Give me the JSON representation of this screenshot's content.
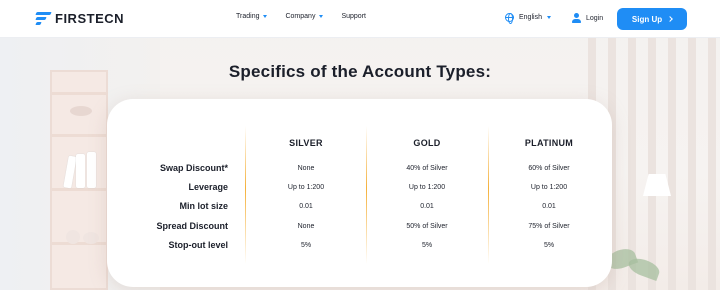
{
  "brand": {
    "name_part1": "FIRST",
    "name_part2": "ECN",
    "accent": "#1f8df5"
  },
  "nav": [
    {
      "label": "Trading",
      "has_dropdown": true
    },
    {
      "label": "Company",
      "has_dropdown": true
    },
    {
      "label": "Support",
      "has_dropdown": false
    }
  ],
  "language": {
    "label": "English",
    "icon": "globe-icon"
  },
  "login": {
    "label": "Login",
    "icon": "user-icon"
  },
  "signup": {
    "label": "Sign Up",
    "icon": "chevron-right-icon"
  },
  "section": {
    "title": "Specifics of the Account Types:"
  },
  "table": {
    "columns": [
      "SILVER",
      "GOLD",
      "PLATINUM"
    ],
    "rows": [
      {
        "label": "Swap Discount*",
        "values": [
          "None",
          "40% of Silver",
          "60% of Silver"
        ]
      },
      {
        "label": "Leverage",
        "values": [
          "Up to 1:200",
          "Up to 1:200",
          "Up to 1:200"
        ]
      },
      {
        "label": "Min lot size",
        "values": [
          "0.01",
          "0.01",
          "0.01"
        ]
      },
      {
        "label": "Spread Discount",
        "values": [
          "None",
          "50% of Silver",
          "75% of Silver"
        ]
      },
      {
        "label": "Stop-out level",
        "values": [
          "5%",
          "5%",
          "5%"
        ]
      }
    ]
  },
  "colors": {
    "primary": "#1f8df5",
    "divider": "#f5b13b",
    "text": "#1b1f2a"
  }
}
